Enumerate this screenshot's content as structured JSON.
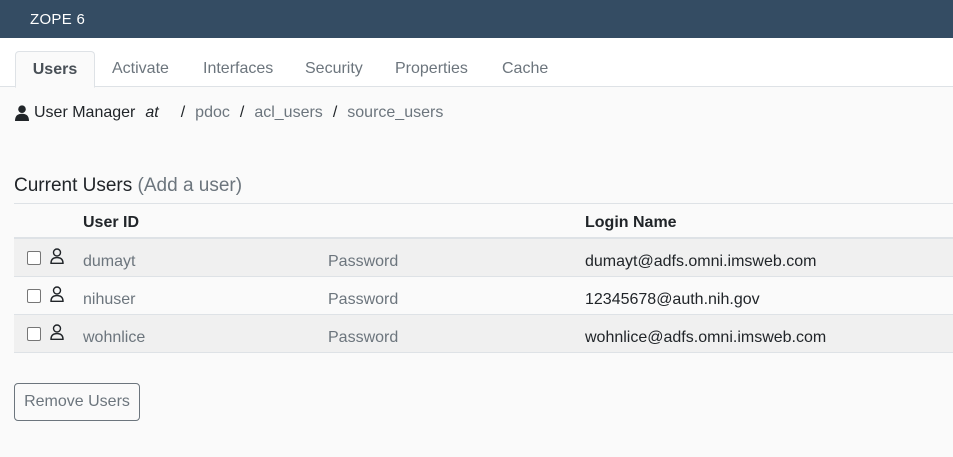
{
  "app": {
    "title": "ZOPE 6"
  },
  "tabs": [
    {
      "label": "Users",
      "active": true
    },
    {
      "label": "Activate"
    },
    {
      "label": "Interfaces"
    },
    {
      "label": "Security"
    },
    {
      "label": "Properties"
    },
    {
      "label": "Cache"
    }
  ],
  "breadcrumb": {
    "icon": "user-icon",
    "title": "User Manager",
    "at": "at",
    "separator": "/",
    "items": [
      "pdoc",
      "acl_users",
      "source_users"
    ]
  },
  "section": {
    "title": "Current Users",
    "add_link": "(Add a user)"
  },
  "table": {
    "columns": {
      "user_id": "User ID",
      "login_name": "Login Name"
    },
    "rows": [
      {
        "user_id": "dumayt",
        "password": "Password",
        "login": "dumayt@adfs.omni.imsweb.com"
      },
      {
        "user_id": "nihuser",
        "password": "Password",
        "login": "12345678@auth.nih.gov"
      },
      {
        "user_id": "wohnlice",
        "password": "Password",
        "login": "wohnlice@adfs.omni.imsweb.com"
      }
    ]
  },
  "actions": {
    "remove_label": "Remove Users"
  },
  "colors": {
    "topbar": "#344c63",
    "muted": "#6c757d",
    "border": "#dee2e6"
  }
}
